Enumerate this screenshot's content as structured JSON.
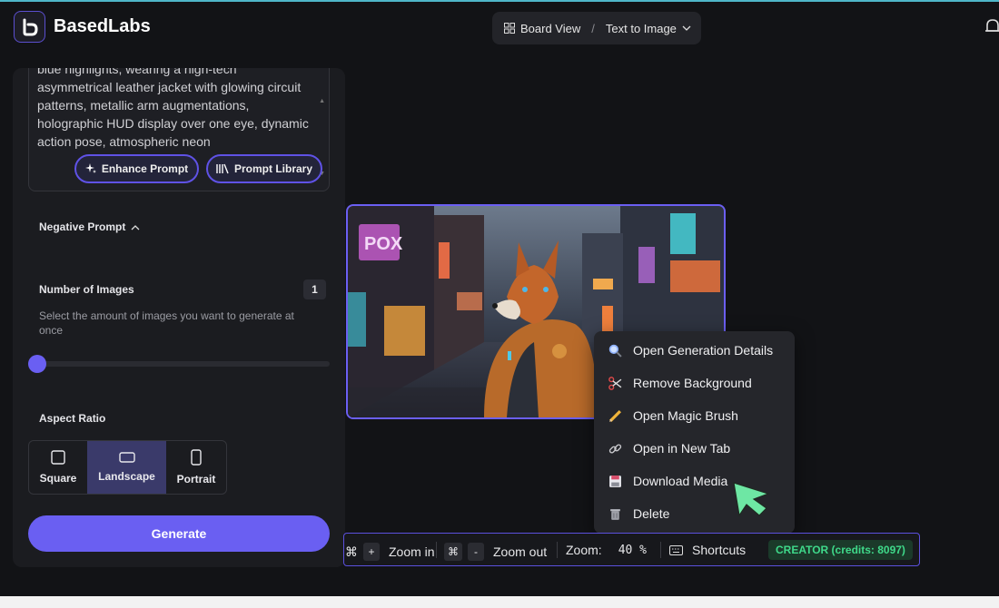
{
  "header": {
    "brand": "BasedLabs",
    "breadcrumb": {
      "view": "Board View",
      "separator": "/",
      "mode": "Text to Image"
    }
  },
  "left_panel": {
    "prompt_text": "blue highlights, wearing a high-tech asymmetrical leather jacket with glowing circuit patterns, metallic arm augmentations, holographic HUD display over one eye, dynamic action pose, atmospheric neon",
    "enhance_prompt_label": "Enhance Prompt",
    "prompt_library_label": "Prompt Library",
    "negative_prompt_label": "Negative Prompt",
    "number_of_images": {
      "label": "Number of Images",
      "value": "1",
      "description": "Select the amount of images you want to generate at once"
    },
    "aspect_ratio": {
      "label": "Aspect Ratio",
      "options": [
        "Square",
        "Landscape",
        "Portrait"
      ],
      "selected": "Landscape"
    },
    "generate_label": "Generate"
  },
  "context_menu": {
    "items": [
      {
        "label": "Open Generation Details",
        "icon": "magnifier-icon"
      },
      {
        "label": "Remove Background",
        "icon": "scissors-icon"
      },
      {
        "label": "Open Magic Brush",
        "icon": "pencil-icon"
      },
      {
        "label": "Open in New Tab",
        "icon": "link-icon"
      },
      {
        "label": "Download Media",
        "icon": "floppy-disk-icon"
      },
      {
        "label": "Delete",
        "icon": "trash-icon"
      }
    ]
  },
  "toolbar": {
    "zoom_in_key": "⌘",
    "zoom_in_symbol": "+",
    "zoom_in_label": "Zoom in",
    "zoom_out_key": "⌘",
    "zoom_out_symbol": "-",
    "zoom_out_label": "Zoom out",
    "zoom_label": "Zoom:",
    "zoom_value": "40 %",
    "shortcuts_label": "Shortcuts",
    "credits": "CREATOR (credits: 8097)"
  },
  "colors": {
    "accent": "#6a5ff2",
    "credits_text": "#3fd98a",
    "background": "#121316"
  }
}
